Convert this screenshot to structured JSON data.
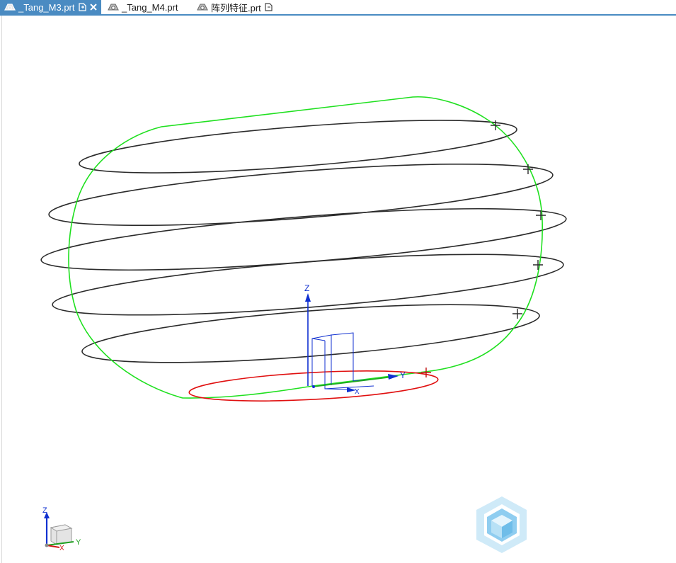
{
  "tabs": [
    {
      "label": "_Tang_M3.prt",
      "active": true,
      "modified": true,
      "closable": true
    },
    {
      "label": "_Tang_M4.prt",
      "active": false,
      "modified": false,
      "closable": false
    },
    {
      "label": "阵列特征.prt",
      "active": false,
      "modified": true,
      "closable": false
    }
  ],
  "viewport": {
    "datum_csys": {
      "z_label": "Z",
      "y_label": "Y",
      "x_label": "X"
    },
    "triad": {
      "z_label": "Z",
      "y_label": "Y",
      "x_label": "X"
    }
  },
  "colors": {
    "tab_active": "#4a8bc2",
    "boundary_curve": "#1fe01f",
    "helix_loops": "#2b2b2b",
    "base_ellipse": "#e01010",
    "datum_axes": "#1030d0",
    "watermark": "#9fd3f0"
  }
}
